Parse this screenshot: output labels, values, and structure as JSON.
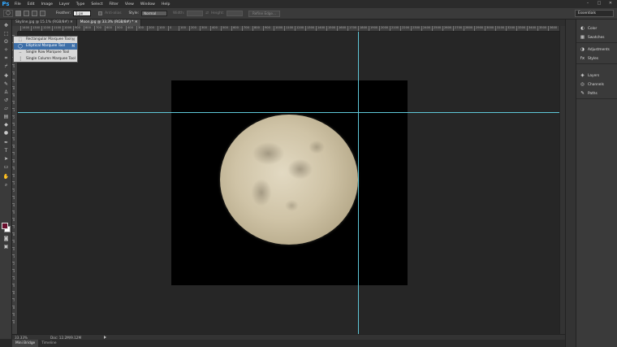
{
  "app": {
    "logo": "Ps",
    "menu": [
      "File",
      "Edit",
      "Image",
      "Layer",
      "Type",
      "Select",
      "Filter",
      "View",
      "Window",
      "Help"
    ],
    "window_controls": [
      "–",
      "□",
      "✕"
    ]
  },
  "options_bar": {
    "feather_label": "Feather:",
    "feather_value": "1 px",
    "anti_alias_label": "Anti-alias",
    "style_label": "Style:",
    "style_value": "Normal",
    "width_label": "Width:",
    "height_label": "Height:",
    "refine_edge_label": "Refine Edge...",
    "workspace_value": "Essentials"
  },
  "tabs": [
    {
      "label": "Skyline.jpg @ 15.1% (RGB/8#) ✕",
      "active": false
    },
    {
      "label": "Moon.jpg @ 33.3% (RGB/8#) * ✕",
      "active": true
    }
  ],
  "ruler": {
    "h_ticks": [
      "1400",
      "1300",
      "1200",
      "1100",
      "1000",
      "900",
      "800",
      "700",
      "600",
      "500",
      "400",
      "300",
      "200",
      "100",
      "0",
      "100",
      "200",
      "300",
      "400",
      "500",
      "600",
      "700",
      "800",
      "900",
      "1000",
      "1100",
      "1200",
      "1300",
      "1400",
      "1500",
      "1600",
      "1700",
      "1800",
      "1900",
      "2000",
      "2100",
      "2200",
      "2300",
      "2400",
      "2500",
      "2600",
      "2700",
      "2800",
      "2900",
      "3000",
      "3100",
      "3200",
      "3300",
      "3400",
      "3500",
      "3600"
    ],
    "v_ticks": [
      "1",
      "2",
      "3",
      "4",
      "5",
      "6",
      "7",
      "8",
      "9",
      "0",
      "1",
      "2",
      "3",
      "4",
      "5",
      "6",
      "7",
      "8",
      "9",
      "0",
      "1",
      "2",
      "3",
      "4",
      "5",
      "6",
      "7",
      "8",
      "9",
      "0",
      "1",
      "2",
      "3",
      "4",
      "5",
      "6",
      "7",
      "8",
      "9",
      "0"
    ]
  },
  "flyout": {
    "items": [
      {
        "label": "Rectangular Marquee Tool",
        "key": "M",
        "icon": "rect-marquee-icon",
        "glyph": "⬚",
        "selected": false
      },
      {
        "label": "Elliptical Marquee Tool",
        "key": "M",
        "icon": "ellipse-marquee-icon",
        "glyph": "◯",
        "selected": true
      },
      {
        "label": "Single Row Marquee Tool",
        "key": "",
        "icon": "row-marquee-icon",
        "glyph": "┄",
        "selected": false
      },
      {
        "label": "Single Column Marquee Tool",
        "key": "",
        "icon": "column-marquee-icon",
        "glyph": "┆",
        "selected": false
      }
    ]
  },
  "status": {
    "zoom": "33.33%",
    "doc": "Doc: 12.2M/9.12M"
  },
  "bottom_tabs": [
    {
      "label": "Mini Bridge",
      "active": true
    },
    {
      "label": "Timeline",
      "active": false
    }
  ],
  "dock": {
    "groups": [
      [
        {
          "label": "Color",
          "icon": "color-icon",
          "glyph": "◐"
        },
        {
          "label": "Swatches",
          "icon": "swatches-icon",
          "glyph": "▦"
        }
      ],
      [
        {
          "label": "Adjustments",
          "icon": "adjustments-icon",
          "glyph": "◑"
        },
        {
          "label": "Styles",
          "icon": "styles-icon",
          "glyph": "fx"
        }
      ],
      [
        {
          "label": "Layers",
          "icon": "layers-icon",
          "glyph": "◈"
        },
        {
          "label": "Channels",
          "icon": "channels-icon",
          "glyph": "◎"
        },
        {
          "label": "Paths",
          "icon": "paths-icon",
          "glyph": "✎"
        }
      ]
    ]
  },
  "colors": {
    "foreground": "#6a0f2e",
    "background": "#ffffff",
    "guide": "#5fc8d8",
    "selection": "#3d6fa8"
  }
}
